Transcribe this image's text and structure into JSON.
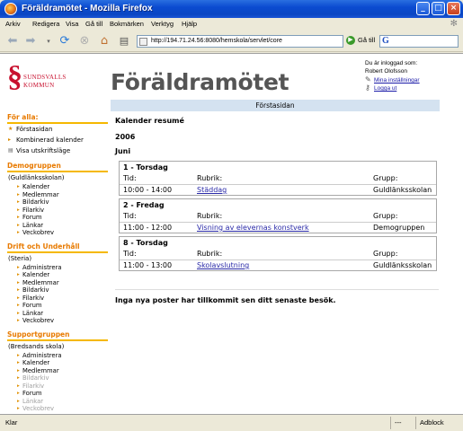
{
  "window": {
    "title": "Föräldramötet - Mozilla Firefox",
    "buttons": [
      "_",
      "□",
      "×"
    ]
  },
  "menu": [
    "Arkiv",
    "Redigera",
    "Visa",
    "Gå till",
    "Bokmärken",
    "Verktyg",
    "Hjälp"
  ],
  "toolbar": {
    "url": "http://194.71.24.56:8080/hemskola/servlet/core",
    "go_label": "Gå till",
    "search_placeholder": "G"
  },
  "header": {
    "logo_line1": "SUNDSVALLS",
    "logo_line2": "KOMMUN",
    "page_title": "Föräldramötet",
    "logged_in_as": "Du är inloggad som:",
    "user_name": "Robert Olofsson",
    "settings_link": "Mina inställningar",
    "logout_link": "Logga ut"
  },
  "pathbar": "Förstasidan",
  "sidebar": {
    "sections": [
      {
        "title": "För alla:",
        "items": [
          "Förstasidan",
          "Kombinerad kalender",
          "Visa utskriftsläge"
        ]
      },
      {
        "title": "Demogruppen",
        "note": "(Guldlänksskolan)",
        "items": [
          "Kalender",
          "Medlemmar",
          "Bildarkiv",
          "Filarkiv",
          "Forum",
          "Länkar",
          "Veckobrev"
        ]
      },
      {
        "title": "Drift och Underhåll",
        "note": "(Steria)",
        "items": [
          "Administrera",
          "Kalender",
          "Medlemmar",
          "Bildarkiv",
          "Filarkiv",
          "Forum",
          "Länkar",
          "Veckobrev"
        ]
      },
      {
        "title": "Supportgruppen",
        "note": "(Bredsands skola)",
        "items": [
          "Administrera",
          "Kalender",
          "Medlemmar",
          "Bildarkiv",
          "Filarkiv",
          "Forum",
          "Länkar",
          "Veckobrev"
        ],
        "disabled": [
          3,
          4,
          6,
          7
        ]
      }
    ]
  },
  "main": {
    "heading": "Kalender resumé",
    "year": "2006",
    "month": "Juni",
    "col_time": "Tid:",
    "col_subject": "Rubrik:",
    "col_group": "Grupp:",
    "events": [
      {
        "day": "1 - Torsdag",
        "time": "10:00 - 14:00",
        "subject": "Städdag",
        "group": "Guldlänksskolan"
      },
      {
        "day": "2 - Fredag",
        "time": "11:00 - 12:00",
        "subject": "Visning av elevernas konstverk",
        "group": "Demogruppen"
      },
      {
        "day": "8 - Torsdag",
        "time": "11:00 - 13:00",
        "subject": "Skolavslutning",
        "group": "Guldlänksskolan"
      }
    ],
    "notice": "Inga nya poster har tillkommit sen ditt senaste besök."
  },
  "statusbar": {
    "status": "Klar",
    "dashes": "---",
    "adblock": "Adblock"
  }
}
